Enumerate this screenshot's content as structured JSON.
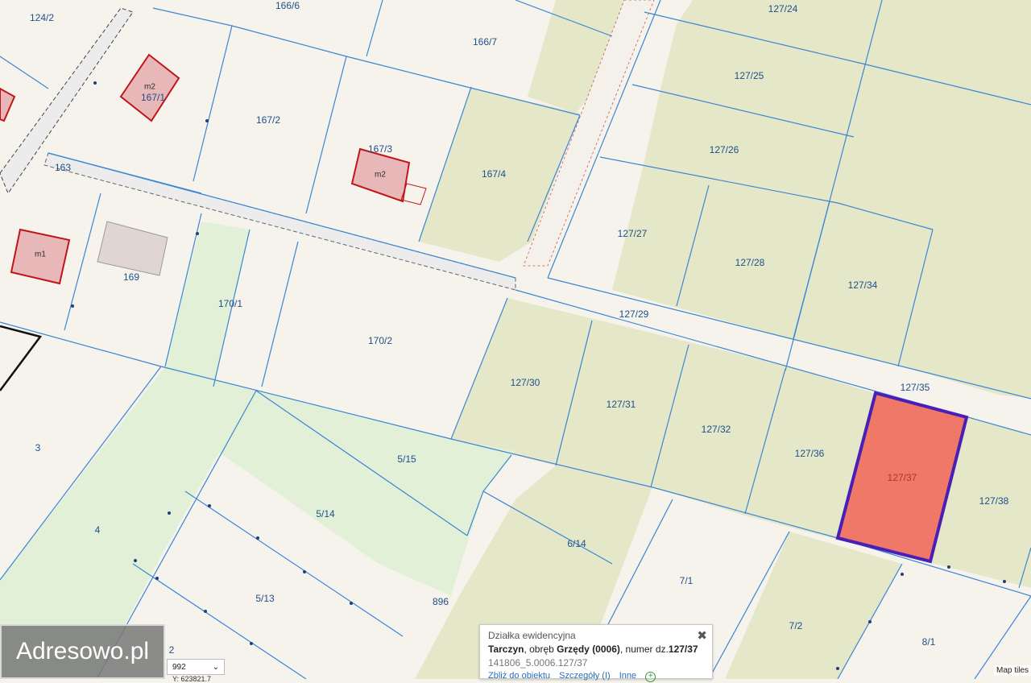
{
  "map": {
    "parcels": [
      {
        "label": "166/6"
      },
      {
        "label": "166/7"
      },
      {
        "label": "127/24"
      },
      {
        "label": "124/2"
      },
      {
        "label": "167/1"
      },
      {
        "label": "167/2"
      },
      {
        "label": "167/3"
      },
      {
        "label": "167/4"
      },
      {
        "label": "127/25"
      },
      {
        "label": "127/26"
      },
      {
        "label": "163"
      },
      {
        "label": "169"
      },
      {
        "label": "127/27"
      },
      {
        "label": "127/28"
      },
      {
        "label": "127/34"
      },
      {
        "label": "170/1"
      },
      {
        "label": "170/2"
      },
      {
        "label": "127/29"
      },
      {
        "label": "127/30"
      },
      {
        "label": "127/31"
      },
      {
        "label": "127/32"
      },
      {
        "label": "127/35"
      },
      {
        "label": "127/36"
      },
      {
        "label": "127/37"
      },
      {
        "label": "127/38"
      },
      {
        "label": "3"
      },
      {
        "label": "5/15"
      },
      {
        "label": "5/14"
      },
      {
        "label": "4"
      },
      {
        "label": "6/14"
      },
      {
        "label": "7/1"
      },
      {
        "label": "5/13"
      },
      {
        "label": "896"
      },
      {
        "label": "7/2"
      },
      {
        "label": "8/1"
      },
      {
        "label": "2"
      }
    ],
    "buildings": [
      {
        "label": "m2"
      },
      {
        "label": "m2"
      },
      {
        "label": "m1"
      }
    ],
    "highlighted_parcel": "127/37",
    "colors": {
      "parcel_line": "#3a86d4",
      "highlight_fill": "#f07868",
      "highlight_border": "#4a1fb8",
      "building_fill": "#e8b8b8",
      "building_border": "#c0161b",
      "agri": "#e5e7c9",
      "meadow": "#e3f0d8",
      "background": "#f6f3ec"
    }
  },
  "logo": {
    "text": "Adresowo.pl"
  },
  "scale": {
    "value": "992"
  },
  "coordinate": {
    "text": "Y: 623821.7"
  },
  "popup": {
    "title": "Działka ewidencyjna",
    "town": "Tarczyn",
    "sep1": ", obręb ",
    "precinct": "Grzędy (0006)",
    "sep2": ", numer dz.",
    "number": "127/37",
    "id": "141806_5.0006.127/37",
    "link_zoom": "Zbliż do obiektu",
    "link_details": "Szczegóły (I)",
    "link_other": "Inne",
    "close_icon": "close-icon",
    "plus_icon": "plus-icon"
  },
  "attribution": {
    "text": "Map tiles"
  }
}
